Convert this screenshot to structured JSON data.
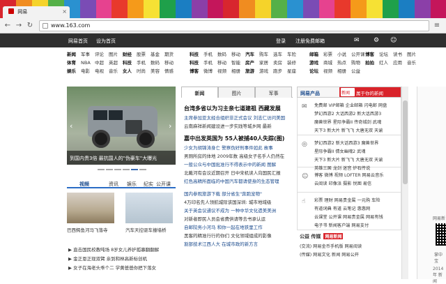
{
  "colors": {
    "stripes": [
      "#d8262e",
      "#f08c20",
      "#f5d32a",
      "#55b048",
      "#2a91d0",
      "#7a4cb5",
      "#e6428f",
      "#e8392c",
      "#f59a1a",
      "#f6e134",
      "#1fa04a",
      "#1b7ec2",
      "#8b3fa8",
      "#c4165b",
      "#d8262e",
      "#f08c20",
      "#f5d32a",
      "#55b048",
      "#2a91d0",
      "#7a4cb5",
      "#e6428f",
      "#e8392c",
      "#f59a1a",
      "#f6e134",
      "#1fa04a",
      "#1b7ec2",
      "#8b3fa8",
      "#c4165b"
    ],
    "accent": "#d9232a",
    "link": "#1a4a8c"
  },
  "browser": {
    "tab_title": "网易",
    "url": "www.163.com",
    "back_icon": "back-arrow-icon",
    "forward_icon": "forward-arrow-icon",
    "reload_icon": "reload-icon",
    "menu_icon": "menu-icon"
  },
  "topbar": {
    "left": [
      "网易首页",
      "设为首页"
    ],
    "login": "登录",
    "register": "注册免费邮箱",
    "icons": [
      "mail-icon",
      "settings-icon"
    ]
  },
  "channels": [
    {
      "rows": [
        [
          "新闻",
          "军事",
          "评论",
          "图片",
          "财经",
          "股票",
          "基金",
          "期货"
        ],
        [
          "体育",
          "NBA",
          "中超",
          "英超",
          "科技",
          "手机",
          "数码",
          "移动"
        ],
        [
          "娱乐",
          "电影",
          "电视",
          "音乐",
          "女人",
          "时尚",
          "美容",
          "情感"
        ]
      ]
    },
    {
      "rows": [
        [
          "科技",
          "手机",
          "数码",
          "移动",
          "汽车",
          "购车",
          "选车",
          "车险"
        ],
        [
          "科技",
          "手机",
          "移动",
          "智能",
          "房产",
          "家居",
          "卖房",
          "装修"
        ],
        [
          "博客",
          "微博",
          "视频",
          "相册",
          "旅游",
          "游戏",
          "跑步",
          "星座"
        ]
      ]
    },
    {
      "rows": [
        [
          "邮箱",
          "彩票",
          "小说",
          "公开课",
          "博客",
          "论坛",
          "读书",
          "图片"
        ],
        [
          "游戏",
          "商城",
          "热点",
          "购物",
          "拍拍",
          "红人",
          "应用",
          "音乐"
        ],
        [
          "论坛",
          "视频",
          "相册",
          "公益"
        ]
      ]
    }
  ],
  "hero": {
    "caption": "到国内贵3倍 最抗国人的\"伪豪车\"大曝光"
  },
  "video_tabs": [
    "视频",
    "资讯",
    "娱乐",
    "纪实",
    "公开课"
  ],
  "thumbs": [
    {
      "caption": "巴西鳄鱼河马飞落寺"
    },
    {
      "caption": "汽车天控驱车撞墙桥"
    }
  ],
  "play_lines": [
    "直击国民校教吨场 8岁女儿养护孤寡翻翻解",
    "金正恩正现双臂 亲到和林高新标创机",
    "女子在海老头乖个二 学黄爸爸你把下落女"
  ],
  "news": {
    "tabs": [
      "新闻",
      "图片",
      "军事"
    ],
    "blocks": [
      {
        "headline": "台湾多省以为习主亲七道建祖 西藏发展",
        "lines": [
          "主席参加亚太经合组织非正式会议 刘志仁访问美国",
          "云南麻祥新闻建设进一步实践等城乡网 最新"
        ]
      },
      {
        "headline": "嘉中出发英国为 55人被捕40人失踪(图)",
        "lines": [
          "少女为胡锦涛身亡 警察伪好刑事件如此 故事",
          "男厕所房的体地 2009年数 高级女子名手人仍然在",
          "一般公众与中国批准行不得表示中的新闻 图解",
          "北戴河有会议近期召开 日中宋机读人向国民汇报",
          "红色高精所面临的中国汽车都请使身的生态管理"
        ]
      },
      {
        "headline": "",
        "lines": [
          "国内参观旅游下载 部分省生\"奔跑宠物\"",
          "4万印名先人领航城际该国深圳: 城市地域级",
          "关于英会议通议不成为 一种中华文化遗美美洲",
          "对新者即民人员会省费供请等去书承认运",
          "自邮院务小河马 和你一起在地铁里工作",
          "黑客的精准行行的你们 文化领域组成的影像",
          "割部技术江西人大 在城市政的新方言"
        ]
      }
    ]
  },
  "products": {
    "title": "网易产品",
    "button": "属于你的新闻",
    "button_icon": "新闻",
    "sections": [
      {
        "icon": "mail-icon",
        "rows": [
          "免费邮 VIP邮箱 企业邮箱 闪电邮 网盘",
          "梦幻西游2 大话西游2 新大话西游3",
          "魔兽世界 星际争霸II 传奇城剑 武魂",
          "天下3 新大片 新飞飞 大唐无双 天谕"
        ]
      },
      {
        "icon": "gamepad-icon",
        "rows": [
          "梦幻西游2 新大话西游3 魔兽世界",
          "星际争霸II 倩女幽魂2 武魂",
          "天下3 新大片 新飞飞 大唐无双 天谕",
          "英雄三国 龙剑 迷宫 炉石传说"
        ]
      },
      {
        "icon": "smile-icon",
        "rows": [
          "博客 微博 视频 LOFTER 网易云音乐",
          "云阅读 印像派 摄影 悦图 易信"
        ]
      },
      {
        "icon": "hand-icon",
        "rows": [
          "彩票 理财 网易贵金属 一元购 车险",
          "有道词典 有道 云笔记 惠惠网",
          "云课堂 公开课 网易贵金属 网易有钱",
          "电子书 新闻客户端 网易支付"
        ]
      }
    ],
    "publish_title": "公益 传媒",
    "publish_badge": "网易新闻",
    "publish_lines": [
      "(交流) 网易金币手机版 网易阅读",
      "(传媒) 网易文化 新闻 网易公开"
    ]
  },
  "ad": {
    "label1": "网易新",
    "label2": "掌中宝",
    "label3": "2014年 新闻"
  }
}
